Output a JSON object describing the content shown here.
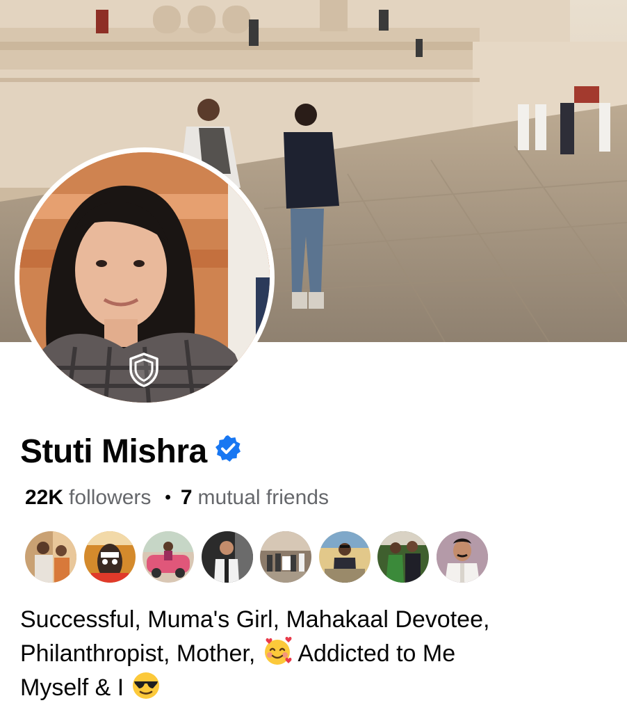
{
  "profile": {
    "name": "Stuti Mishra",
    "followers_count": "22K",
    "followers_label": "followers",
    "separator": "•",
    "mutual_count": "7",
    "mutual_label": "mutual friends",
    "bio_line1": "Successful, Muma's Girl, Mahakaal Devotee,",
    "bio_line2a": "Philanthropist, Mother,",
    "bio_line2b": "Addicted to Me",
    "bio_line3a": "Myself & I"
  },
  "icons": {
    "verified": "verified-badge-icon",
    "profile_guard": "shield-icon",
    "emoji_love": "smiling-face-with-hearts-emoji",
    "emoji_cool": "smiling-face-with-sunglasses-emoji"
  },
  "mutual_friends": [
    {
      "label": "mutual-friend-1",
      "bg": "#c9a173"
    },
    {
      "label": "mutual-friend-2",
      "bg": "#d48a2c"
    },
    {
      "label": "mutual-friend-3",
      "bg": "#b5546a"
    },
    {
      "label": "mutual-friend-4",
      "bg": "#3a3a3a"
    },
    {
      "label": "mutual-friend-5",
      "bg": "#8c7b6a"
    },
    {
      "label": "mutual-friend-6",
      "bg": "#e2c88a"
    },
    {
      "label": "mutual-friend-7",
      "bg": "#3f5f2e"
    },
    {
      "label": "mutual-friend-8",
      "bg": "#a38a98"
    }
  ],
  "colors": {
    "verified_blue": "#1877f2",
    "secondary_text": "#65676b",
    "primary_text": "#050505"
  }
}
